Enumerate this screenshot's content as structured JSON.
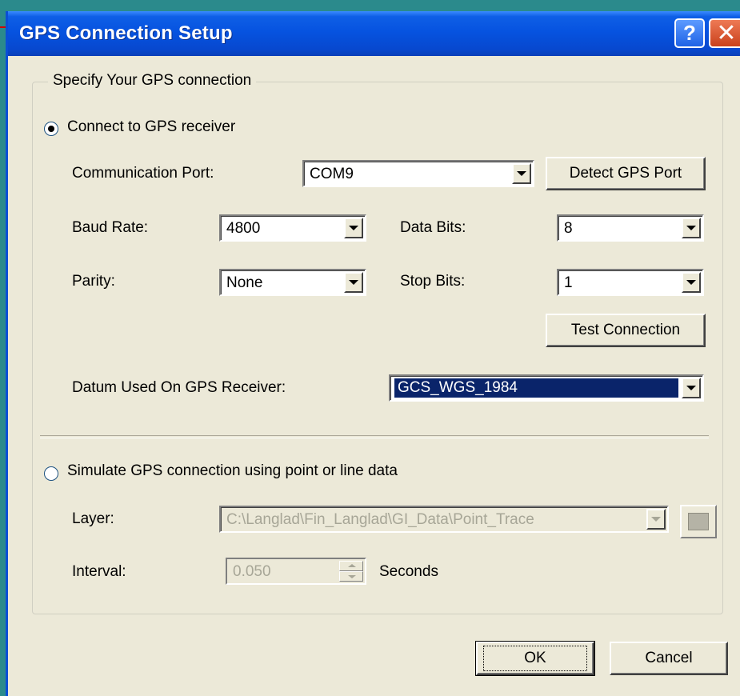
{
  "window": {
    "title": "GPS Connection Setup",
    "help_glyph": "?",
    "close_glyph": "✕"
  },
  "group": {
    "legend": "Specify Your GPS connection"
  },
  "connect": {
    "radio_label": "Connect to GPS receiver",
    "checked": true,
    "comm_port_label": "Communication Port:",
    "comm_port_value": "COM9",
    "detect_button": "Detect GPS Port",
    "baud_label": "Baud Rate:",
    "baud_value": "4800",
    "data_bits_label": "Data Bits:",
    "data_bits_value": "8",
    "parity_label": "Parity:",
    "parity_value": "None",
    "stop_bits_label": "Stop Bits:",
    "stop_bits_value": "1",
    "test_button": "Test Connection",
    "datum_label": "Datum Used On GPS Receiver:",
    "datum_value": "GCS_WGS_1984"
  },
  "simulate": {
    "radio_label": "Simulate GPS connection using point or line data",
    "checked": false,
    "layer_label": "Layer:",
    "layer_value": "C:\\Langlad\\Fin_Langlad\\GI_Data\\Point_Trace",
    "interval_label": "Interval:",
    "interval_value": "0.050",
    "seconds_label": "Seconds"
  },
  "footer": {
    "ok_button": "OK",
    "cancel_button": "Cancel"
  },
  "colors": {
    "titlebar": "#0653e0",
    "dialog_bg": "#ece9d8",
    "selection": "#0a246a",
    "desktop": "#2b8a8c"
  },
  "icons": [
    "help-icon",
    "close-icon",
    "radio-icon",
    "dropdown-arrow-icon",
    "browse-folder-icon",
    "spin-up-icon",
    "spin-down-icon"
  ]
}
